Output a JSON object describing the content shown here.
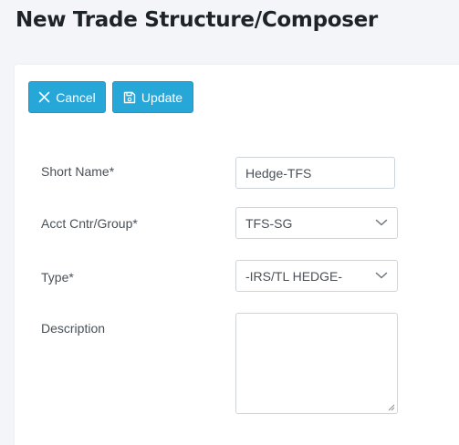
{
  "page": {
    "title": "New Trade Structure/Composer"
  },
  "toolbar": {
    "cancel_label": "Cancel",
    "update_label": "Update"
  },
  "form": {
    "short_name": {
      "label": "Short Name*",
      "value": "Hedge-TFS"
    },
    "acct_group": {
      "label": "Acct Cntr/Group*",
      "value": "TFS-SG"
    },
    "type": {
      "label": "Type*",
      "value": "-IRS/TL HEDGE-"
    },
    "description": {
      "label": "Description",
      "value": ""
    }
  },
  "colors": {
    "accent": "#27a6d8",
    "background": "#f3f5f8",
    "title": "#1e2328"
  },
  "icons": {
    "cancel": "close-icon",
    "update": "save-icon",
    "dropdown": "chevron-down-icon"
  }
}
